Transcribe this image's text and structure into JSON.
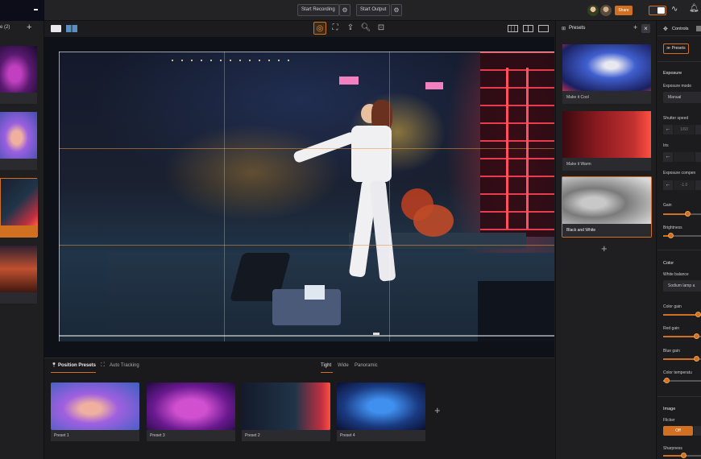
{
  "topbar": {
    "start_recording": "Start Recording",
    "start_output": "Start Output",
    "share": "Share"
  },
  "left_strip": {
    "header": "e (2)",
    "add": "+"
  },
  "bottom": {
    "tabs": [
      {
        "label": "Position Presets",
        "active": true
      },
      {
        "label": "Auto Tracking",
        "active": false
      }
    ],
    "framing": [
      {
        "label": "Tight",
        "active": true
      },
      {
        "label": "Wide",
        "active": false
      },
      {
        "label": "Panoramic",
        "active": false
      }
    ],
    "presets": [
      {
        "label": "Preset 1"
      },
      {
        "label": "Preset 3"
      },
      {
        "label": "Preset 2"
      },
      {
        "label": "Preset 4"
      }
    ],
    "add": "+"
  },
  "presets_panel": {
    "title": "Presets",
    "add": "+",
    "close": "×",
    "items": [
      {
        "label": "Make it Cool"
      },
      {
        "label": "Make it Warm"
      },
      {
        "label": "Black and White",
        "selected": true
      }
    ],
    "add_bottom": "+"
  },
  "controls": {
    "title": "Controls",
    "presets_button": "Presets",
    "exposure_head": "Exposure",
    "exposure_mode_label": "Exposure mode",
    "exposure_mode_value": "Manual",
    "shutter_label": "Shutter speed",
    "shutter_value": "1/60",
    "iris_label": "Iris",
    "exp_comp_label": "Exposure compen",
    "exp_comp_value": "-1.0",
    "gain_label": "Gain",
    "gain_level": 0.65,
    "brightness_label": "Brightness",
    "brightness_level": 0.2,
    "color_head": "Color",
    "wb_label": "White balance",
    "wb_value": "Sodium lamp a",
    "color_gain_label": "Color gain",
    "color_gain_level": 1.0,
    "red_gain_label": "Red gain",
    "red_gain_level": 0.88,
    "blue_gain_label": "Blue gain",
    "blue_gain_level": 0.88,
    "temp_label": "Color temperatu",
    "temp_level": 0.1,
    "image_head": "Image",
    "flicker_label": "Flicker",
    "flicker_value": "Off",
    "sharpness_label": "Sharpness",
    "sharpness_level": 0.55
  },
  "colors": {
    "accent": "#d07020",
    "panel": "#1f1f22",
    "background": "#1c1c1e"
  }
}
